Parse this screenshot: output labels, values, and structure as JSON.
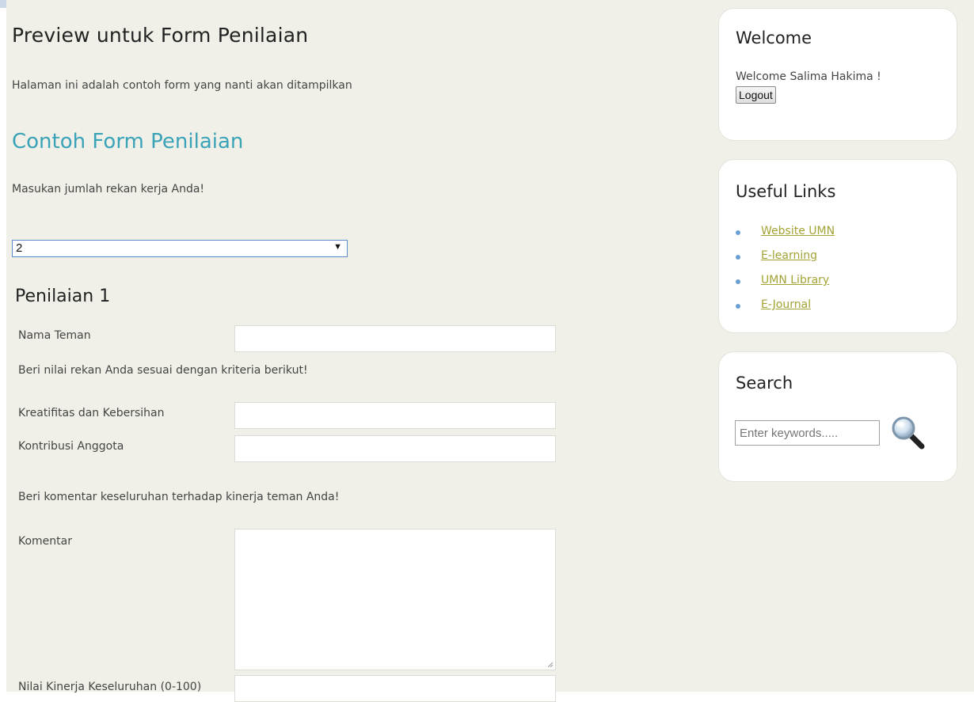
{
  "main": {
    "title": "Preview untuk Form Penilaian",
    "intro": "Halaman ini adalah contoh form yang nanti akan ditampilkan",
    "section_title": "Contoh Form Penilaian",
    "count_prompt": "Masukan jumlah rekan kerja Anda!",
    "count_select_value": "2"
  },
  "penilaian": {
    "title": "Penilaian 1",
    "nama_label": "Nama Teman",
    "nilai_prompt": "Beri nilai rekan Anda sesuai dengan kriteria berikut!",
    "criteria": [
      {
        "label": "Kreatifitas dan Kebersihan"
      },
      {
        "label": "Kontribusi Anggota"
      }
    ],
    "komentar_prompt": "Beri komentar keseluruhan terhadap kinerja teman Anda!",
    "komentar_label": "Komentar",
    "nilai_keseluruhan_label": "Nilai Kinerja Keseluruhan (0-100)"
  },
  "sidebar": {
    "welcome": {
      "title": "Welcome",
      "text": "Welcome Salima Hakima !",
      "logout_label": "Logout"
    },
    "useful_links": {
      "title": "Useful Links",
      "items": [
        "Website UMN",
        "E-learning",
        "UMN Library",
        "E-Journal"
      ]
    },
    "search": {
      "title": "Search",
      "placeholder": "Enter keywords.....",
      "button_icon": "magnifier-icon"
    }
  },
  "colors": {
    "background": "#f0f0e9",
    "section_title": "#3aa3b8",
    "link": "#a3a335",
    "bullet": "#6a9fd6"
  }
}
